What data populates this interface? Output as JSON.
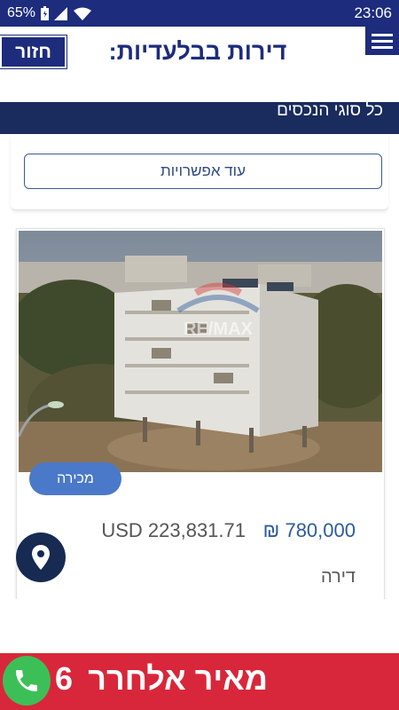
{
  "status_bar": {
    "battery": "65%",
    "time": "23:06"
  },
  "header": {
    "back_label": "חזור",
    "title": "דירות בבלעדיות:"
  },
  "filter": {
    "property_types_label": "כל סוגי הנכסים"
  },
  "more_options": {
    "label": "עוד אפשרויות"
  },
  "listing": {
    "badge": "מכירה",
    "price_ils": "₪ 780,000",
    "price_usd": "USD 223,831.71",
    "property_type": "דירה",
    "photo_watermark": "RE/MAX"
  },
  "promo": {
    "text": "מאיר אלחרר",
    "number": "6"
  },
  "colors": {
    "brand_navy": "#1d2c7c",
    "promo_red": "#d8273a",
    "badge_blue": "#4a79c9",
    "phone_green": "#3dbf57"
  }
}
